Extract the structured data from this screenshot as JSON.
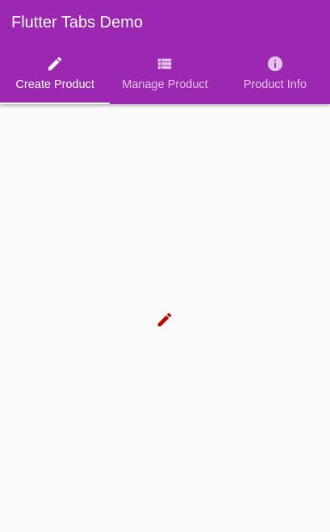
{
  "appbar": {
    "title": "Flutter Tabs Demo",
    "background_color": "#9c27b0"
  },
  "tabs": [
    {
      "label": "Create Product",
      "icon": "edit-pencil-icon",
      "active": true
    },
    {
      "label": "Manage Product",
      "icon": "list-view-icon",
      "active": false
    },
    {
      "label": "Product Info",
      "icon": "info-icon",
      "active": false
    }
  ],
  "content": {
    "icon": "edit-pencil-icon",
    "icon_color": "#c00000"
  }
}
